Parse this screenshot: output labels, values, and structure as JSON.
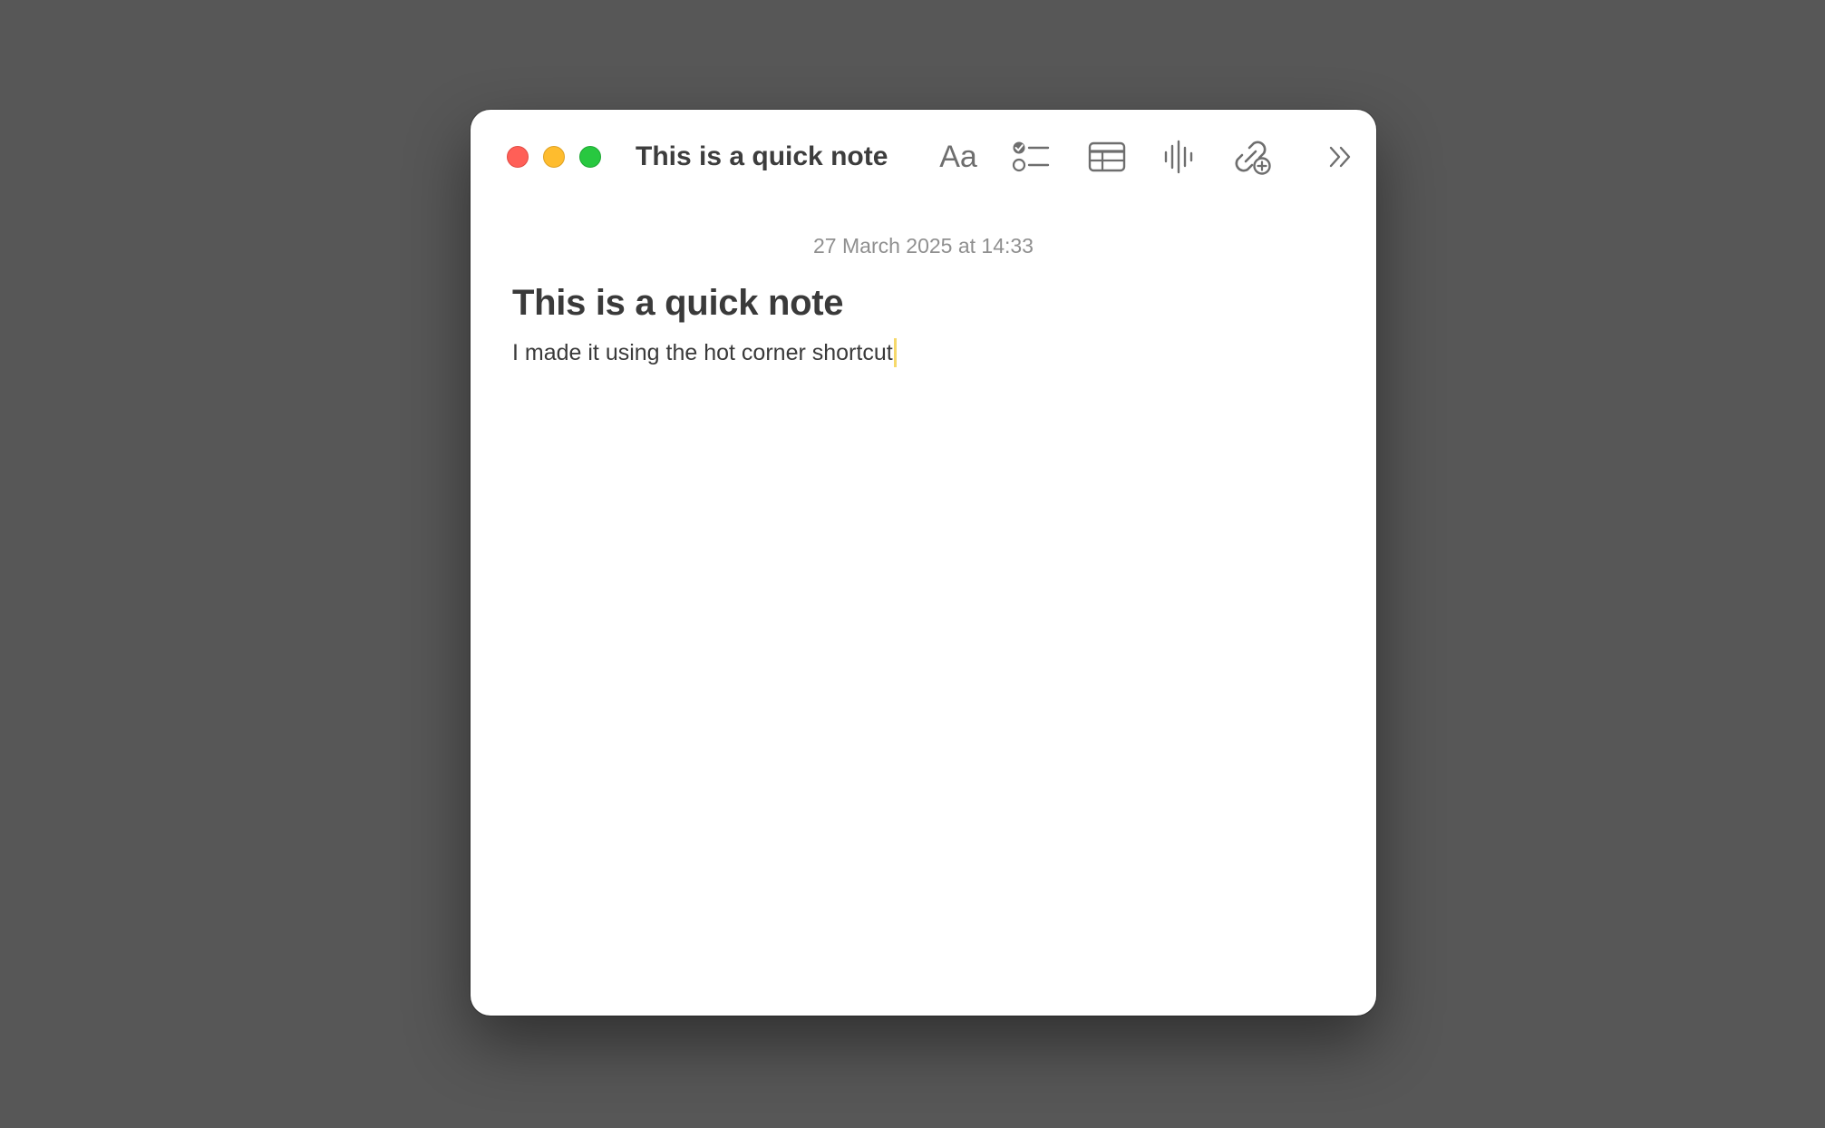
{
  "window": {
    "title": "This is a quick note"
  },
  "toolbar": {
    "format_label": "Aa",
    "format_icon": "text-format-icon",
    "checklist_icon": "checklist-icon",
    "table_icon": "table-icon",
    "audio_icon": "audio-waveform-icon",
    "link_icon": "add-link-icon",
    "more_icon": "chevron-double-right-icon"
  },
  "note": {
    "timestamp": "27 March 2025 at 14:33",
    "heading": "This is a quick note",
    "body": "I made it using the hot corner shortcut"
  },
  "colors": {
    "desktop": "#575757",
    "close": "#ff5f57",
    "minimize": "#febc2e",
    "zoom": "#28c840",
    "caret": "#f6d96b"
  }
}
